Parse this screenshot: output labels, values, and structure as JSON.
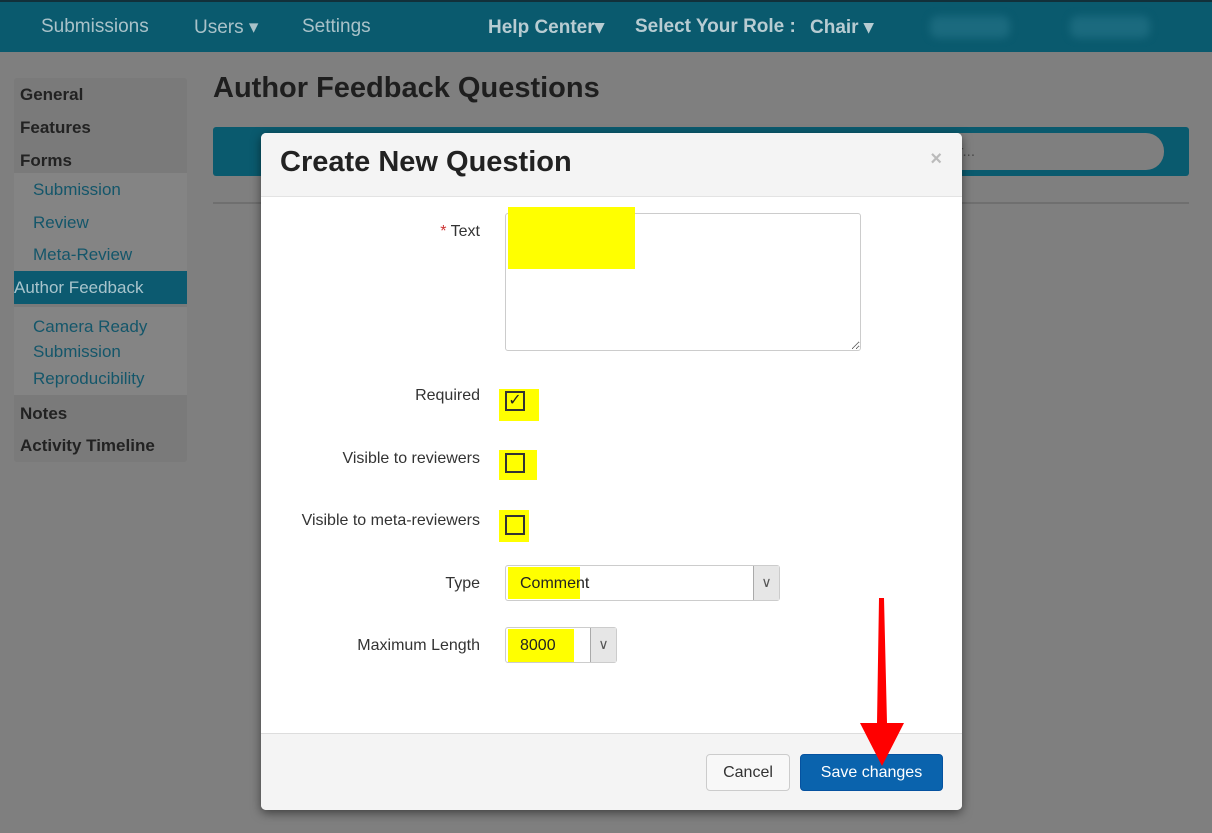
{
  "nav": {
    "items": [
      "Submissions",
      "Users ▾",
      "Settings"
    ],
    "help": "Help Center▾",
    "role_label": "Select Your Role :",
    "role_value": "Chair ▾"
  },
  "sidebar": {
    "items": [
      {
        "label": "General",
        "type": "h"
      },
      {
        "label": "Features",
        "type": "h"
      },
      {
        "label": "Forms",
        "type": "h"
      },
      {
        "label": "Submission",
        "type": "s"
      },
      {
        "label": "Review",
        "type": "s"
      },
      {
        "label": "Meta-Review",
        "type": "s"
      },
      {
        "label": "Author Feedback",
        "type": "a"
      },
      {
        "label": "Camera Ready Submission",
        "type": "s"
      },
      {
        "label": "Reproducibility",
        "type": "s"
      },
      {
        "label": "Notes",
        "type": "h"
      },
      {
        "label": "Activity Timeline",
        "type": "h"
      }
    ]
  },
  "page": {
    "title": "Author Feedback Questions",
    "search_placeholder": "er..."
  },
  "modal": {
    "title": "Create New Question",
    "close": "×",
    "required_mark": "*",
    "text_label": "Text",
    "text_value": "",
    "required_label": "Required",
    "required_checked": true,
    "visible_reviewers_label": "Visible to reviewers",
    "visible_reviewers_checked": false,
    "visible_meta_label": "Visible to meta-reviewers",
    "visible_meta_checked": false,
    "type_label": "Type",
    "type_value": "Comment",
    "maxlen_label": "Maximum Length",
    "maxlen_value": "8000",
    "cancel": "Cancel",
    "save": "Save changes"
  },
  "colors": {
    "highlight": "#ffff00",
    "arrow": "#ff0000",
    "primary": "#0a63ad"
  }
}
